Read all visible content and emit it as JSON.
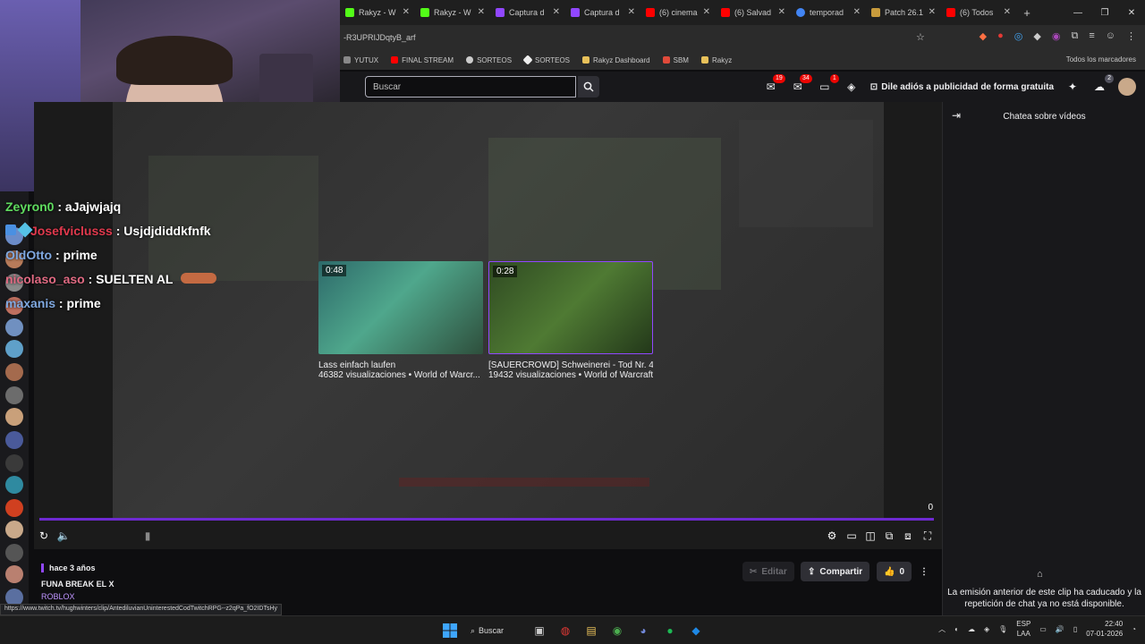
{
  "browser": {
    "tabs": [
      {
        "label": "Rakyz - W",
        "color": "#53fc18"
      },
      {
        "label": "Rakyz - W",
        "color": "#53fc18"
      },
      {
        "label": "Captura d",
        "color": "#9147ff"
      },
      {
        "label": "Captura d",
        "color": "#9147ff"
      },
      {
        "label": "(6) cinema",
        "color": "#ff0000"
      },
      {
        "label": "(6) Salvad",
        "color": "#ff0000"
      },
      {
        "label": "temporad",
        "color": "#4285f4"
      },
      {
        "label": "Patch 26.1",
        "color": "#c89b3c"
      },
      {
        "label": "(6) Todos",
        "color": "#ff0000"
      }
    ],
    "new_tab_glyph": "+",
    "url": "-R3UPRIJDqtyB_arf",
    "bookmarks": [
      "YUTUX",
      "FINAL STREAM",
      "SORTEOS",
      "SORTEOS",
      "Rakyz Dashboard",
      "SBM",
      "Rakyz"
    ],
    "bookmarks_all": "Todos los marcadores",
    "status_url": "https://www.twitch.tv/hughwinters/clip/AntediluvianUninterestedCodTwitchRPG--z2qPa_fO2IDTsHy"
  },
  "twitch": {
    "search_placeholder": "Buscar",
    "badges": {
      "inbox": "19",
      "notifications": "34",
      "whispers": "1",
      "bits": "2"
    },
    "promo_label": "Dile adiós a publicidad de forma gratuita",
    "recommendations": [
      {
        "duration": "0:48",
        "title": "Lass einfach laufen",
        "meta": "46382 visualizaciones • World of Warcr..."
      },
      {
        "duration": "0:28",
        "title": "[SAUERCROWD] Schweinerei - Tod Nr. 4",
        "meta": "19432 visualizaciones • World of Warcraft"
      }
    ],
    "counter": "0",
    "clip": {
      "age": "hace 3 años",
      "title": "FUNA BREAK EL X",
      "game": "ROBLOX",
      "edit_label": "Editar",
      "share_label": "Compartir",
      "likes": "0"
    },
    "chat": {
      "title": "Chatea sobre vídeos",
      "expired_message": "La emisión anterior de este clip ha caducado y la repetición de chat ya no está disponible."
    }
  },
  "overlay_chat": [
    {
      "user": "Zeyron0",
      "color": "#5fdc5f",
      "message": "aJajwjajq"
    },
    {
      "user": "Josefviclusss",
      "color": "#e0394d",
      "message": "Usjdjdiddkfnfk"
    },
    {
      "user": "OldOtto",
      "color": "#7fa8e0",
      "message": "prime"
    },
    {
      "user": "nicolaso_aso",
      "color": "#e06a82",
      "message": "SUELTEN AL"
    },
    {
      "user": "maxanis",
      "color": "#7fa8e0",
      "message": "prime"
    }
  ],
  "taskbar": {
    "search_label": "Buscar",
    "lang_top": "ESP",
    "lang_bottom": "LAA",
    "time": "22:40",
    "date": "07-01-2026"
  }
}
